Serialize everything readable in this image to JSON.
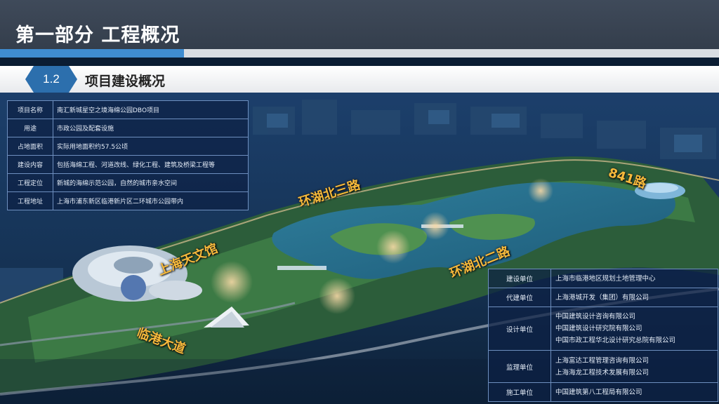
{
  "header": {
    "title": "第一部分  工程概况"
  },
  "section": {
    "number": "1.2",
    "title": "项目建设概况"
  },
  "project_info": [
    {
      "key": "项目名称",
      "value": "南汇新城星空之境海绵公园DBO项目"
    },
    {
      "key": "用途",
      "value": "市政公园及配套设施"
    },
    {
      "key": "占地面积",
      "value": "实际用地面积约57.5公顷"
    },
    {
      "key": "建设内容",
      "value": "包括海绵工程、河道改线、绿化工程、建筑及桥梁工程等"
    },
    {
      "key": "工程定位",
      "value": "新城的海绵示范公园，自然的城市亲水空间"
    },
    {
      "key": "工程地址",
      "value": "上海市浦东新区临港新片区二环城市公园带内"
    }
  ],
  "units": [
    {
      "key": "建设单位",
      "values": [
        "上海市临港地区规划土地管理中心"
      ]
    },
    {
      "key": "代建单位",
      "values": [
        "上海港城开发（集团）有限公司"
      ]
    },
    {
      "key": "设计单位",
      "values": [
        "中国建筑设计咨询有限公司",
        "中国建筑设计研究院有限公司",
        "中国市政工程华北设计研究总院有限公司"
      ]
    },
    {
      "key": "监理单位",
      "values": [
        "上海富达工程管理咨询有限公司",
        "上海海龙工程技术发展有限公司"
      ]
    },
    {
      "key": "施工单位",
      "values": [
        "中国建筑第八工程局有限公司"
      ]
    }
  ],
  "map_labels": {
    "road_north3": "环湖北三路",
    "road_841": "841路",
    "road_north2": "环湖北二路",
    "planetarium": "上海天文馆",
    "lingang": "临港大道"
  },
  "colors": {
    "accent": "#3f8dd1",
    "label": "#f6b93b",
    "badge": "#2c6fad"
  }
}
